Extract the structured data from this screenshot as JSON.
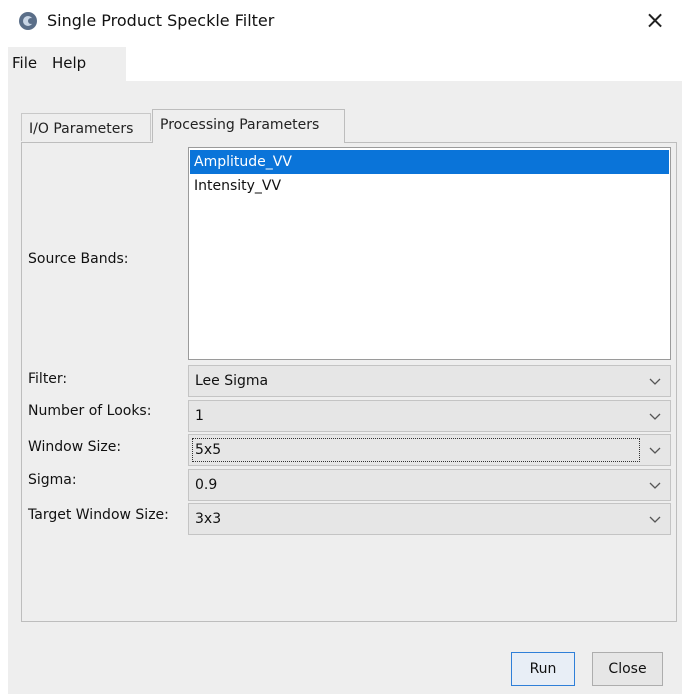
{
  "window": {
    "title": "Single Product Speckle Filter",
    "icon": "app-logo-icon",
    "close_glyph": "×"
  },
  "menu": {
    "items": [
      {
        "label": "File"
      },
      {
        "label": "Help"
      }
    ]
  },
  "tabs": [
    {
      "label": "I/O Parameters",
      "selected": false
    },
    {
      "label": "Processing Parameters",
      "selected": true
    }
  ],
  "form": {
    "source_bands": {
      "label": "Source Bands:",
      "items": [
        {
          "label": "Amplitude_VV",
          "selected": true
        },
        {
          "label": "Intensity_VV",
          "selected": false
        }
      ]
    },
    "filter": {
      "label": "Filter:",
      "value": "Lee Sigma"
    },
    "number_of_looks": {
      "label": "Number of Looks:",
      "value": "1"
    },
    "window_size": {
      "label": "Window Size:",
      "value": "5x5",
      "focused": true
    },
    "sigma": {
      "label": "Sigma:",
      "value": "0.9"
    },
    "target_window_size": {
      "label": "Target Window Size:",
      "value": "3x3"
    }
  },
  "buttons": {
    "run": "Run",
    "close": "Close"
  },
  "colors": {
    "selection": "#0a74d9",
    "panel_bg": "#eeeeee",
    "focus_border": "#2f7fd8"
  }
}
